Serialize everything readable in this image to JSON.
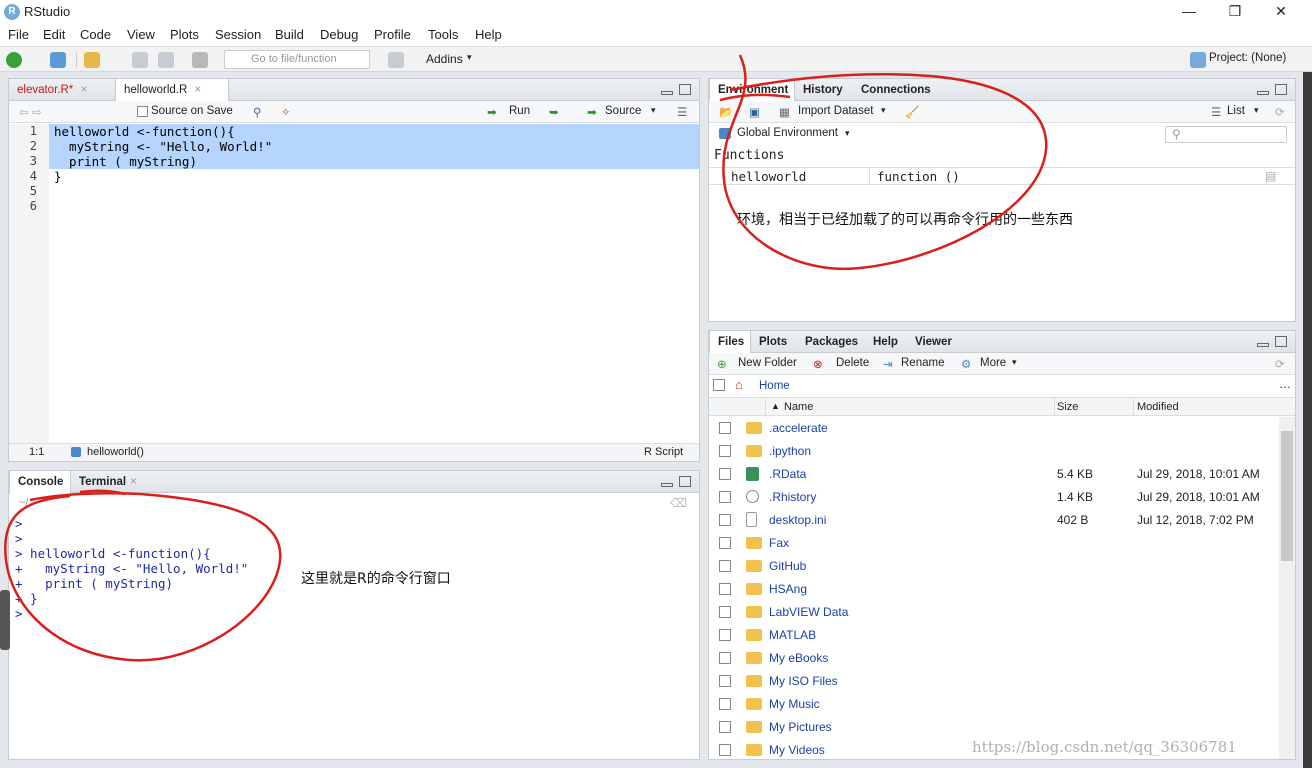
{
  "window": {
    "title": "RStudio",
    "logo": "R"
  },
  "menu": [
    "File",
    "Edit",
    "Code",
    "View",
    "Plots",
    "Session",
    "Build",
    "Debug",
    "Profile",
    "Tools",
    "Help"
  ],
  "toolbar": {
    "goto_placeholder": "Go to file/function",
    "addins": "Addins",
    "project": "Project: (None)"
  },
  "editor": {
    "tabs": [
      {
        "label": "elevator.R*",
        "active": false
      },
      {
        "label": "helloworld.R",
        "active": true
      }
    ],
    "toolbar": {
      "source_on_save": "Source on Save",
      "run": "Run",
      "source": "Source"
    },
    "lines": [
      "helloworld <-function(){",
      "  myString <- \"Hello, World!\"",
      "  print ( myString)",
      "}",
      "",
      ""
    ],
    "line_numbers": [
      "1",
      "2",
      "3",
      "4",
      "5",
      "6"
    ],
    "status": {
      "position": "1:1",
      "scope": "helloworld()",
      "filetype": "R Script"
    }
  },
  "console": {
    "tabs": [
      {
        "label": "Console",
        "active": true
      },
      {
        "label": "Terminal",
        "active": false
      }
    ],
    "path": "~/",
    "lines": [
      ">",
      ">",
      "> helloworld <-function(){",
      "+   myString <- \"Hello, World!\"",
      "+   print ( myString)",
      "+ }",
      ">"
    ],
    "annotation": "这里就是R的命令行窗口"
  },
  "environment": {
    "tabs": [
      {
        "label": "Environment",
        "active": true
      },
      {
        "label": "History",
        "active": false
      },
      {
        "label": "Connections",
        "active": false
      }
    ],
    "toolbar": {
      "import": "Import Dataset",
      "view": "List"
    },
    "scope": "Global Environment",
    "section": "Functions",
    "rows": [
      {
        "name": "helloworld",
        "value": "function ()"
      }
    ],
    "annotation": "环境，相当于已经加载了的可以再命令行用的一些东西"
  },
  "files": {
    "tabs": [
      {
        "label": "Files",
        "active": true
      },
      {
        "label": "Plots",
        "active": false
      },
      {
        "label": "Packages",
        "active": false
      },
      {
        "label": "Help",
        "active": false
      },
      {
        "label": "Viewer",
        "active": false
      }
    ],
    "toolbar": {
      "new_folder": "New Folder",
      "delete": "Delete",
      "rename": "Rename",
      "more": "More"
    },
    "breadcrumb": "Home",
    "columns": {
      "name": "Name",
      "size": "Size",
      "modified": "Modified"
    },
    "rows": [
      {
        "name": ".accelerate",
        "size": "",
        "modified": "",
        "icon": "folder-icon"
      },
      {
        "name": ".ipython",
        "size": "",
        "modified": "",
        "icon": "folder-icon"
      },
      {
        "name": ".RData",
        "size": "5.4 KB",
        "modified": "Jul 29, 2018, 10:01 AM",
        "icon": "rdata-icon"
      },
      {
        "name": ".Rhistory",
        "size": "1.4 KB",
        "modified": "Jul 29, 2018, 10:01 AM",
        "icon": "history-icon"
      },
      {
        "name": "desktop.ini",
        "size": "402 B",
        "modified": "Jul 12, 2018, 7:02 PM",
        "icon": "file-icon"
      },
      {
        "name": "Fax",
        "size": "",
        "modified": "",
        "icon": "folder-icon"
      },
      {
        "name": "GitHub",
        "size": "",
        "modified": "",
        "icon": "folder-icon"
      },
      {
        "name": "HSAng",
        "size": "",
        "modified": "",
        "icon": "folder-icon"
      },
      {
        "name": "LabVIEW Data",
        "size": "",
        "modified": "",
        "icon": "folder-icon"
      },
      {
        "name": "MATLAB",
        "size": "",
        "modified": "",
        "icon": "folder-icon"
      },
      {
        "name": "My eBooks",
        "size": "",
        "modified": "",
        "icon": "folder-icon"
      },
      {
        "name": "My ISO Files",
        "size": "",
        "modified": "",
        "icon": "folder-icon"
      },
      {
        "name": "My Music",
        "size": "",
        "modified": "",
        "icon": "folder-icon"
      },
      {
        "name": "My Pictures",
        "size": "",
        "modified": "",
        "icon": "folder-icon"
      },
      {
        "name": "My Videos",
        "size": "",
        "modified": "",
        "icon": "folder-icon"
      }
    ]
  },
  "watermark": "https://blog.csdn.net/qq_36306781",
  "colors": {
    "accent": "#75aadb",
    "selection": "#b5d5ff",
    "annotation": "#d9201b",
    "link": "#1a3fa8"
  }
}
